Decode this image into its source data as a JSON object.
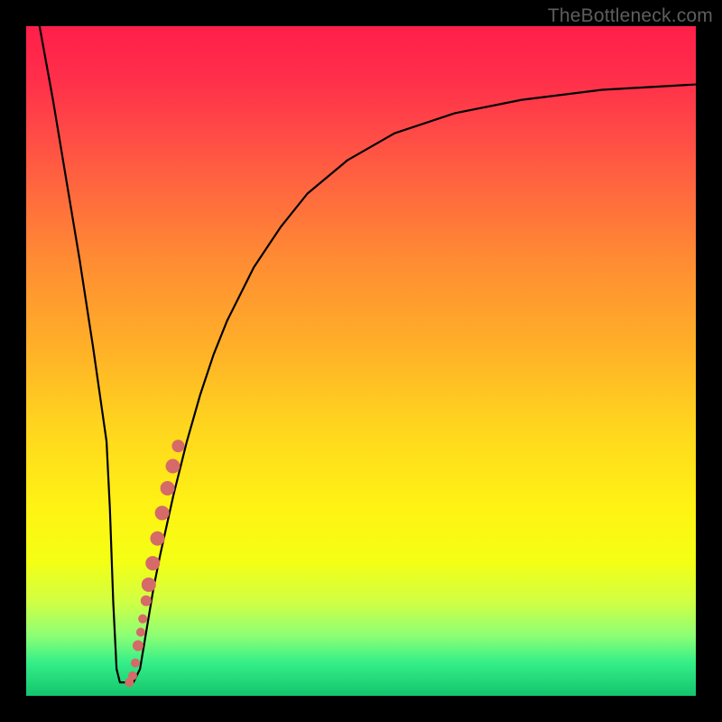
{
  "watermark": "TheBottleneck.com",
  "chart_data": {
    "type": "line",
    "title": "",
    "xlabel": "",
    "ylabel": "",
    "xlim": [
      0,
      100
    ],
    "ylim": [
      0,
      100
    ],
    "series": [
      {
        "name": "bottleneck-curve",
        "x": [
          2,
          4,
          6,
          8,
          10,
          11,
          12,
          12.5,
          13,
          13.5,
          14,
          15,
          16,
          17,
          18,
          19,
          20,
          22,
          24,
          26,
          28,
          30,
          34,
          38,
          42,
          48,
          55,
          64,
          74,
          86,
          100
        ],
        "y": [
          100,
          89,
          77,
          65,
          52,
          45,
          38,
          28,
          14,
          4,
          2,
          2,
          2,
          4,
          10,
          16,
          21,
          30,
          38,
          45,
          51,
          56,
          64,
          70,
          75,
          80,
          84,
          87,
          89,
          90.5,
          91.3
        ]
      }
    ],
    "scatter": {
      "name": "highlight-points",
      "color": "#d56a68",
      "points": [
        {
          "x": 15.4,
          "y": 2.0,
          "r": 5
        },
        {
          "x": 15.9,
          "y": 3.0,
          "r": 5
        },
        {
          "x": 16.3,
          "y": 4.9,
          "r": 5
        },
        {
          "x": 16.7,
          "y": 7.5,
          "r": 6
        },
        {
          "x": 17.1,
          "y": 9.5,
          "r": 5
        },
        {
          "x": 17.4,
          "y": 11.5,
          "r": 5
        },
        {
          "x": 17.9,
          "y": 14.2,
          "r": 6
        },
        {
          "x": 18.3,
          "y": 16.6,
          "r": 8
        },
        {
          "x": 18.9,
          "y": 19.8,
          "r": 8
        },
        {
          "x": 19.6,
          "y": 23.5,
          "r": 8
        },
        {
          "x": 20.3,
          "y": 27.3,
          "r": 8
        },
        {
          "x": 21.1,
          "y": 31.0,
          "r": 8
        },
        {
          "x": 21.9,
          "y": 34.3,
          "r": 8
        },
        {
          "x": 22.7,
          "y": 37.3,
          "r": 7
        }
      ]
    },
    "gradient_stops": [
      {
        "pos": 0.0,
        "color": "#ff1f4a"
      },
      {
        "pos": 0.25,
        "color": "#ff6a3e"
      },
      {
        "pos": 0.5,
        "color": "#ffb028"
      },
      {
        "pos": 0.72,
        "color": "#fff314"
      },
      {
        "pos": 0.91,
        "color": "#8dff74"
      },
      {
        "pos": 1.0,
        "color": "#13c56d"
      }
    ]
  }
}
